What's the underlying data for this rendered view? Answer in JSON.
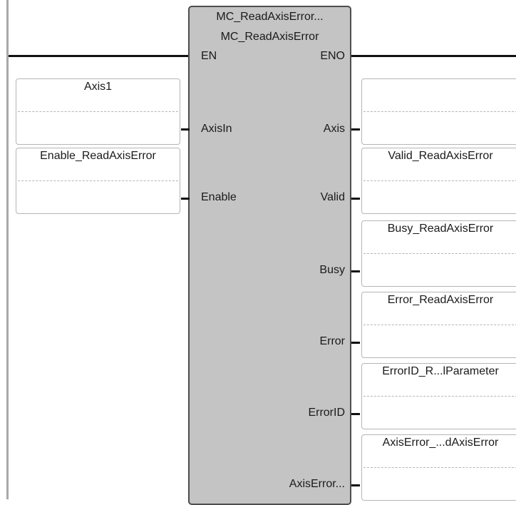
{
  "function_block": {
    "instance_name": "MC_ReadAxisError...",
    "type_name": "MC_ReadAxisError",
    "inputs": {
      "en": "EN",
      "axis_in": "AxisIn",
      "enable": "Enable"
    },
    "outputs": {
      "eno": "ENO",
      "axis": "Axis",
      "valid": "Valid",
      "busy": "Busy",
      "error": "Error",
      "error_id": "ErrorID",
      "axis_error": "AxisError..."
    }
  },
  "input_variables": {
    "axis_in": "Axis1",
    "enable": "Enable_ReadAxisError"
  },
  "output_variables": {
    "axis": "",
    "valid": "Valid_ReadAxisError",
    "busy": "Busy_ReadAxisError",
    "error": "Error_ReadAxisError",
    "error_id": "ErrorID_R...lParameter",
    "axis_error": "AxisError_...dAxisError"
  }
}
